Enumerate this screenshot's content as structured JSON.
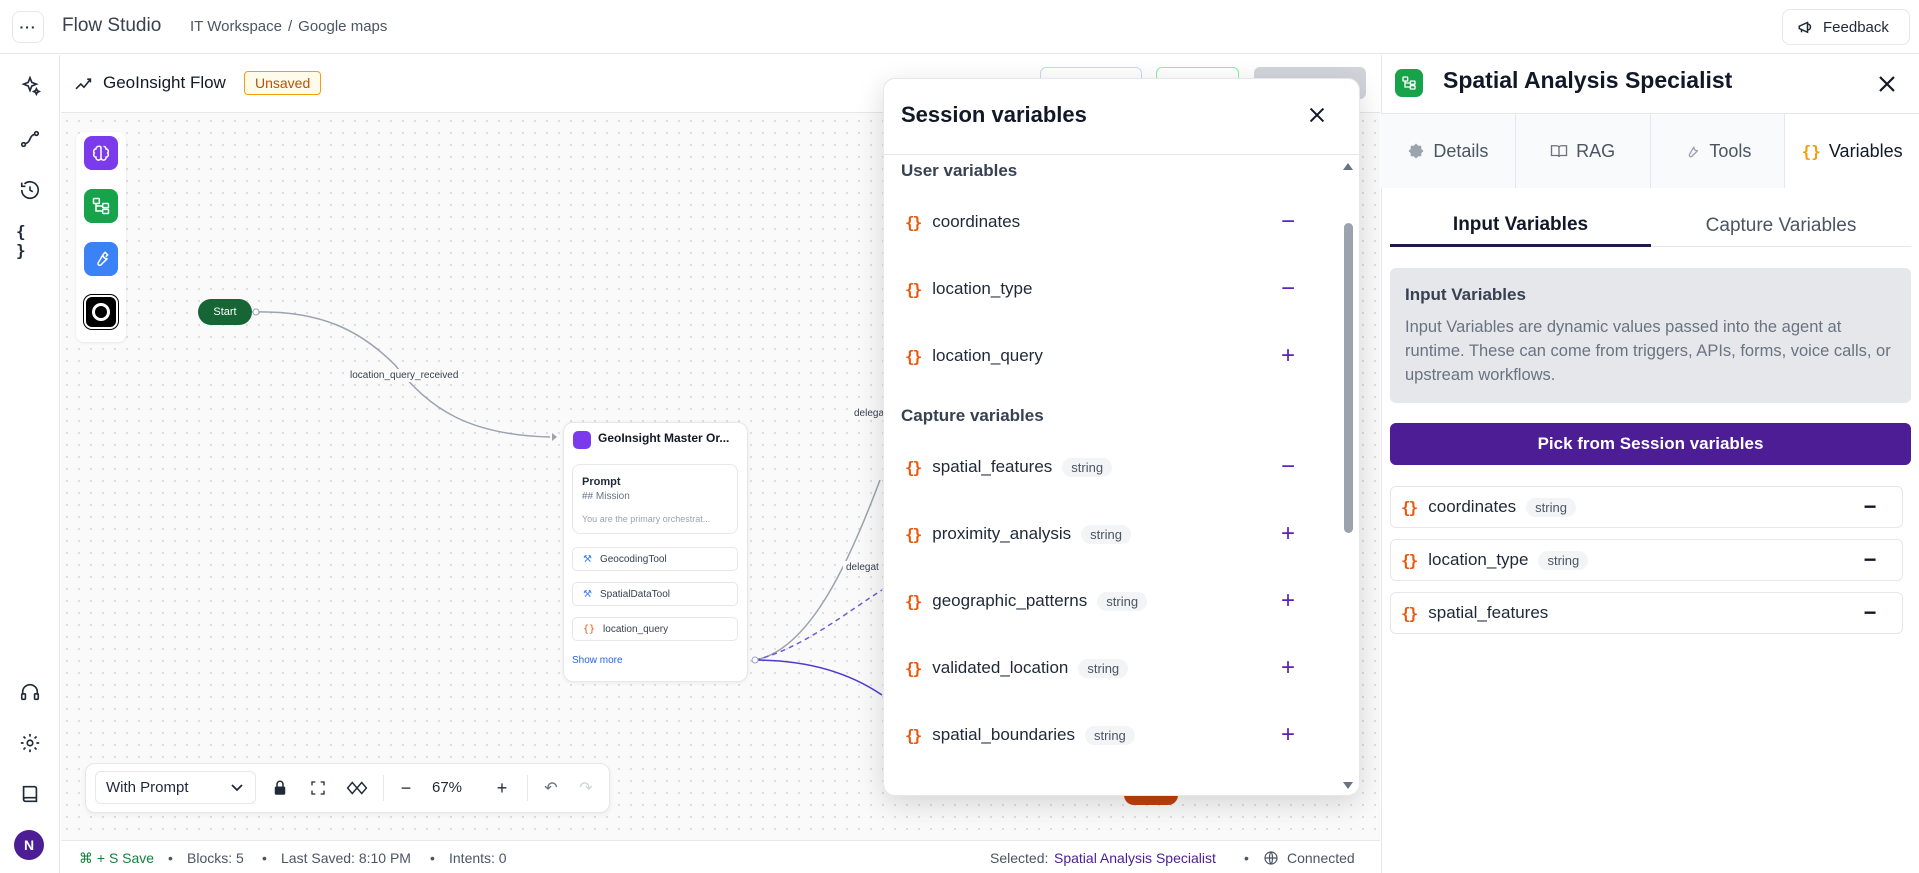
{
  "app": {
    "title": "Flow Studio",
    "breadcrumb": [
      "IT Workspace",
      "/",
      "Google maps"
    ],
    "feedback_label": "Feedback"
  },
  "flow": {
    "title": "GeoInsight Flow",
    "unsaved_label": "Unsaved"
  },
  "canvas": {
    "start_label": "Start",
    "edge_labels": [
      "location_query_received",
      "delega",
      "delegat"
    ],
    "master_node": {
      "title": "GeoInsight Master Or...",
      "prompt_title": "Prompt",
      "prompt_mission": "## Mission",
      "prompt_preview": "You are the primary orchestrat...",
      "rows": [
        "GeocodingTool",
        "SpatialDataTool",
        "location_query"
      ],
      "show_more": "Show more"
    }
  },
  "toolbar": {
    "mode": "With Prompt",
    "zoom": "67%"
  },
  "statusbar": {
    "save_hint": "⌘ + S Save",
    "blocks": "Blocks: 5",
    "last_saved": "Last Saved: 8:10 PM",
    "intents": "Intents: 0",
    "selected_prefix": "Selected:",
    "selected_name": "Spatial Analysis Specialist",
    "connection": "Connected",
    "sep": "•"
  },
  "session_popup": {
    "title": "Session variables",
    "user_section": "User variables",
    "capture_section": "Capture variables",
    "user_vars": [
      {
        "name": "coordinates",
        "action": "−"
      },
      {
        "name": "location_type",
        "action": "−"
      },
      {
        "name": "location_query",
        "action": "+"
      }
    ],
    "capture_vars": [
      {
        "name": "spatial_features",
        "type": "string",
        "action": "−"
      },
      {
        "name": "proximity_analysis",
        "type": "string",
        "action": "+"
      },
      {
        "name": "geographic_patterns",
        "type": "string",
        "action": "+"
      },
      {
        "name": "validated_location",
        "type": "string",
        "action": "+"
      },
      {
        "name": "spatial_boundaries",
        "type": "string",
        "action": "+"
      }
    ]
  },
  "right_panel": {
    "title": "Spatial Analysis Specialist",
    "tabs": [
      "Details",
      "RAG",
      "Tools",
      "Variables"
    ],
    "subtabs": [
      "Input Variables",
      "Capture Variables"
    ],
    "info_title": "Input Variables",
    "info_text": "Input Variables are dynamic values passed into the agent at runtime. These can come from triggers, APIs, forms, voice calls, or upstream workflows.",
    "pick_button": "Pick from Session variables",
    "vars": [
      {
        "name": "coordinates",
        "type": "string"
      },
      {
        "name": "location_type",
        "type": "string"
      },
      {
        "name": "spatial_features",
        "type": ""
      }
    ],
    "brace": "{}"
  },
  "colors": {
    "accent": "#4c1d95",
    "brace": "#ea580c",
    "start_node": "#166534"
  }
}
